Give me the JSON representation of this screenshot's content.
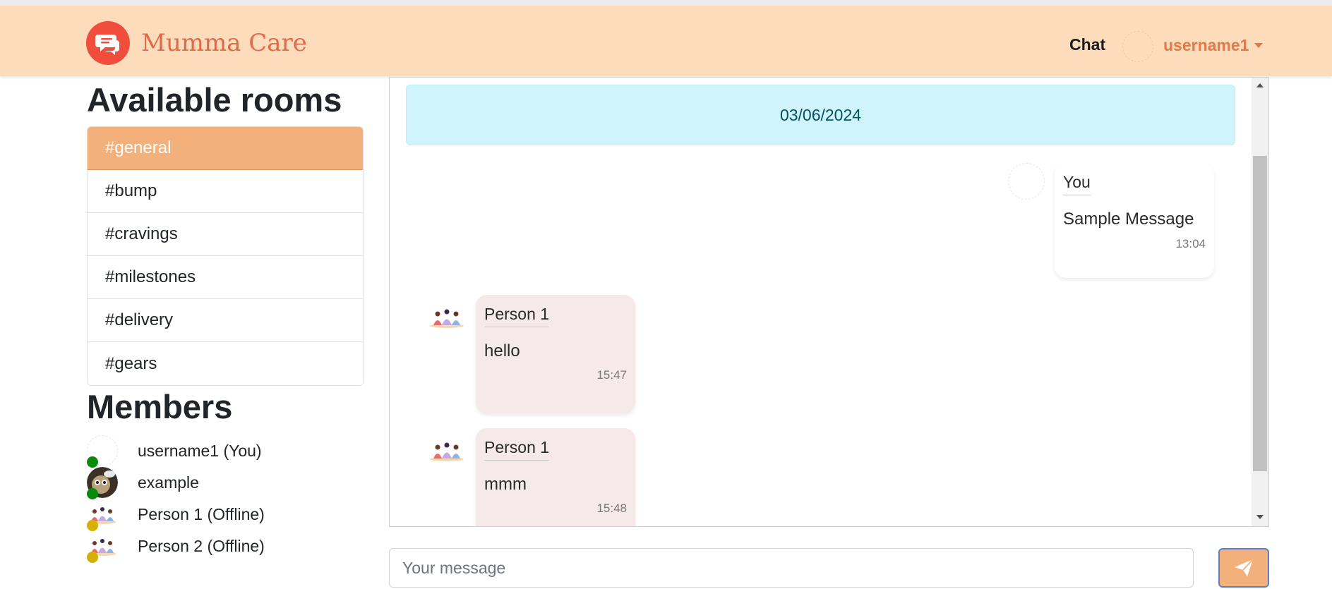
{
  "app": {
    "name": "Mumma Care",
    "brand_color": "#f04d3c",
    "accent": "#f4b07b"
  },
  "nav": {
    "chat_label": "Chat",
    "username": "username1"
  },
  "sidebar": {
    "rooms_title": "Available rooms",
    "rooms": [
      {
        "label": "#general",
        "active": true
      },
      {
        "label": "#bump",
        "active": false
      },
      {
        "label": "#cravings",
        "active": false
      },
      {
        "label": "#milestones",
        "active": false
      },
      {
        "label": "#delivery",
        "active": false
      },
      {
        "label": "#gears",
        "active": false
      }
    ],
    "members_title": "Members",
    "members": [
      {
        "name": "username1 (You)",
        "status": "online",
        "avatar": "blank-avatar"
      },
      {
        "name": "example",
        "status": "online",
        "avatar": "photo-avatar"
      },
      {
        "name": "Person 1 (Offline)",
        "status": "offline",
        "avatar": "meditation-avatar"
      },
      {
        "name": "Person 2 (Offline)",
        "status": "offline",
        "avatar": "meditation-avatar"
      }
    ],
    "status_colors": {
      "online": "#0a8a0a",
      "offline": "#d4b000"
    }
  },
  "chat": {
    "date": "03/06/2024",
    "messages": [
      {
        "sender": "You",
        "text": "Sample Message",
        "time": "13:04",
        "mine": true
      },
      {
        "sender": "Person 1",
        "text": "hello",
        "time": "15:47",
        "mine": false
      },
      {
        "sender": "Person 1",
        "text": "mmm",
        "time": "15:48",
        "mine": false
      }
    ]
  },
  "composer": {
    "placeholder": "Your message",
    "send_icon": "paper-plane-icon"
  }
}
